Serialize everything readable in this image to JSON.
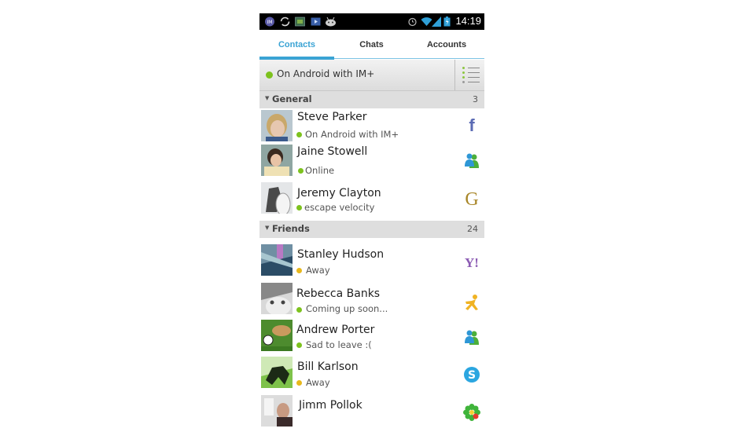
{
  "status_bar": {
    "time": "14:19",
    "left_icons": [
      "im-plus-icon",
      "sync-icon",
      "image-icon",
      "video-icon",
      "android-icon"
    ],
    "right_icons": [
      "alarm-icon",
      "wifi-icon",
      "signal-icon",
      "battery-icon"
    ]
  },
  "tabs": [
    {
      "label": "Contacts",
      "active": true
    },
    {
      "label": "Chats",
      "active": false
    },
    {
      "label": "Accounts",
      "active": false
    }
  ],
  "my_status": {
    "text": "On Android with IM+",
    "color": "#7dc21e"
  },
  "groups": [
    {
      "name": "General",
      "count": "3",
      "contacts": [
        {
          "name": "Steve Parker",
          "status": "On Android with IM+",
          "presence": "online",
          "network": "facebook-icon"
        },
        {
          "name": "Jaine Stowell",
          "status": "Online",
          "presence": "online",
          "network": "msn-icon"
        },
        {
          "name": "Jeremy Clayton",
          "status": "escape velocity",
          "presence": "online",
          "network": "gtalk-icon"
        }
      ]
    },
    {
      "name": "Friends",
      "count": "24",
      "contacts": [
        {
          "name": "Stanley Hudson",
          "status": "Away",
          "presence": "away",
          "network": "yahoo-icon"
        },
        {
          "name": "Rebecca Banks",
          "status": "Coming up soon...",
          "presence": "online",
          "network": "aim-icon"
        },
        {
          "name": "Andrew Porter",
          "status": "Sad to leave :(",
          "presence": "online",
          "network": "msn-icon"
        },
        {
          "name": "Bill Karlson",
          "status": "Away",
          "presence": "away",
          "network": "skype-icon"
        },
        {
          "name": "Jimm Pollok",
          "status": "",
          "presence": "online",
          "network": "icq-icon"
        }
      ]
    }
  ],
  "colors": {
    "accent": "#3aa3d4",
    "online": "#7dc21e",
    "away": "#e8b81c"
  }
}
